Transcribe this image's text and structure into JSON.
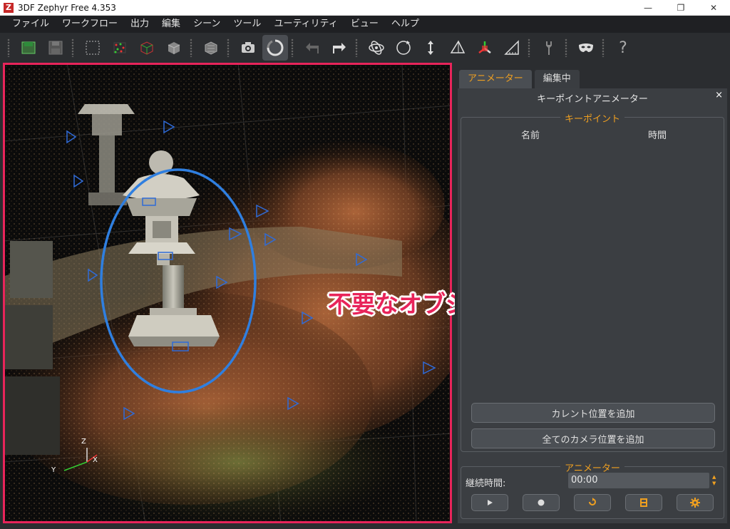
{
  "window": {
    "title": "3DF Zephyr Free 4.353",
    "logo_letter": "Z",
    "controls": [
      "—",
      "❐",
      "✕"
    ]
  },
  "menu": [
    "ファイル",
    "ワークフロー",
    "出力",
    "編集",
    "シーン",
    "ツール",
    "ユーティリティ",
    "ビュー",
    "ヘルプ"
  ],
  "toolbar": {
    "icons": [
      "new-project-icon",
      "save-icon",
      "select-box-icon",
      "sparse-cloud-icon",
      "dense-cloud-icon",
      "mesh-icon",
      "textured-mesh-icon",
      "camera-icon",
      "loading-spinner-icon",
      "undo-icon",
      "redo-icon",
      "orbit-icon",
      "rotate-icon",
      "move-vertical-icon",
      "plane-icon",
      "axis-gizmo-icon",
      "measure-icon",
      "tools-icon",
      "mask-icon",
      "help-icon"
    ],
    "help_label": "?"
  },
  "viewport": {
    "axis_z": "Z",
    "axis_x": "X",
    "axis_y": "Y",
    "annotation": "不要なオブジェクトを除去",
    "colors": {
      "frame": "#e8245a",
      "ellipse": "#2f7fe0"
    }
  },
  "panel": {
    "tabs": [
      {
        "label": "アニメーター",
        "active": true
      },
      {
        "label": "編集中",
        "active": false
      }
    ],
    "title": "キーポイントアニメーター",
    "close": "×",
    "keypoints": {
      "title": "キーポイント",
      "col_name": "名前",
      "col_time": "時間",
      "add_current": "カレント位置を追加",
      "add_all_cameras": "全てのカメラ位置を追加"
    },
    "animator": {
      "title": "アニメーター",
      "duration_label": "継続時間:",
      "duration_value": "00:00",
      "controls": [
        "play-icon",
        "record-icon",
        "loop-icon",
        "film-icon",
        "settings-icon"
      ]
    },
    "accent": "#f0a020"
  }
}
